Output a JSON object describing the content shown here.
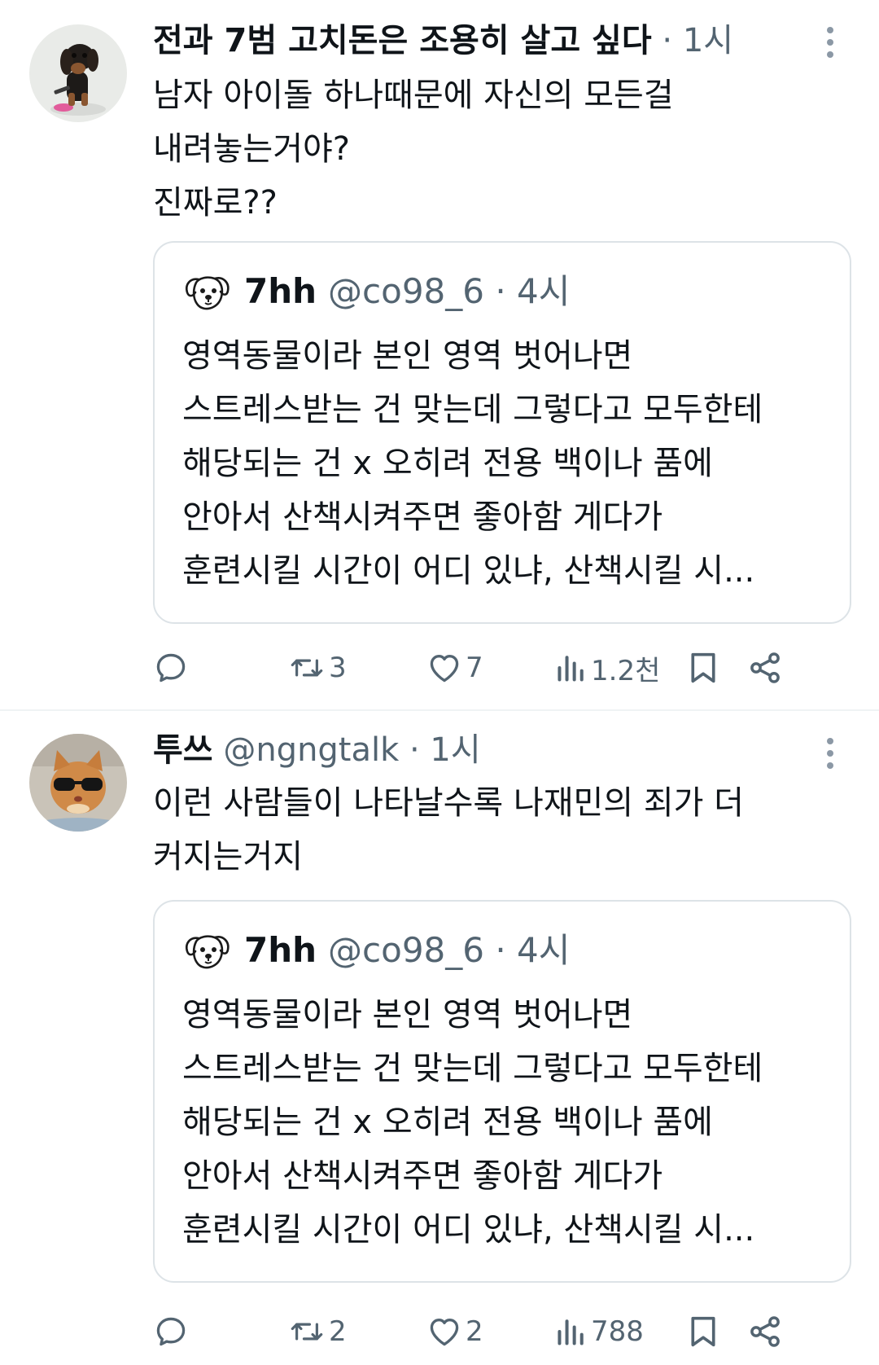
{
  "tweets": [
    {
      "author_name": "전과 7범 고치돈은 조용히 살고 싶다",
      "meta": " · 1시",
      "avatar_icon": "dachshund-avatar",
      "body_lines": [
        "남자 아이돌 하나때문에 자신의 모든걸",
        "내려놓는거야?",
        "진짜로??"
      ],
      "quote": {
        "author_name": "7hh",
        "meta": "@co98_6 · 4시",
        "avatar_icon": "dog-face-icon",
        "lines": [
          "영역동물이라 본인 영역 벗어나면",
          "스트레스받는 건 맞는데 그렇다고 모두한테",
          "해당되는 건 x 오히려 전용 백이나 품에",
          "안아서 산책시켜주면 좋아함 게다가",
          "훈련시킬 시간이 어디 있냐, 산책시킬 시..."
        ]
      },
      "actions": {
        "retweets": "3",
        "likes": "7",
        "views": "1.2천"
      }
    },
    {
      "author_name": "투쓰",
      "meta": " @ngngtalk · 1시",
      "avatar_icon": "cat-sunglasses-avatar",
      "body_lines": [
        "이런 사람들이 나타날수록 나재민의 죄가 더",
        "커지는거지"
      ],
      "quote": {
        "author_name": "7hh",
        "meta": "@co98_6 · 4시",
        "avatar_icon": "dog-face-icon",
        "lines": [
          "영역동물이라 본인 영역 벗어나면",
          "스트레스받는 건 맞는데 그렇다고 모두한테",
          "해당되는 건 x 오히려 전용 백이나 품에",
          "안아서 산책시켜주면 좋아함 게다가",
          "훈련시킬 시간이 어디 있냐, 산책시킬 시..."
        ]
      },
      "actions": {
        "retweets": "2",
        "likes": "2",
        "views": "788"
      }
    }
  ],
  "colors": {
    "text": "#0f1419",
    "secondary": "#536471",
    "border": "#dde3e7"
  }
}
